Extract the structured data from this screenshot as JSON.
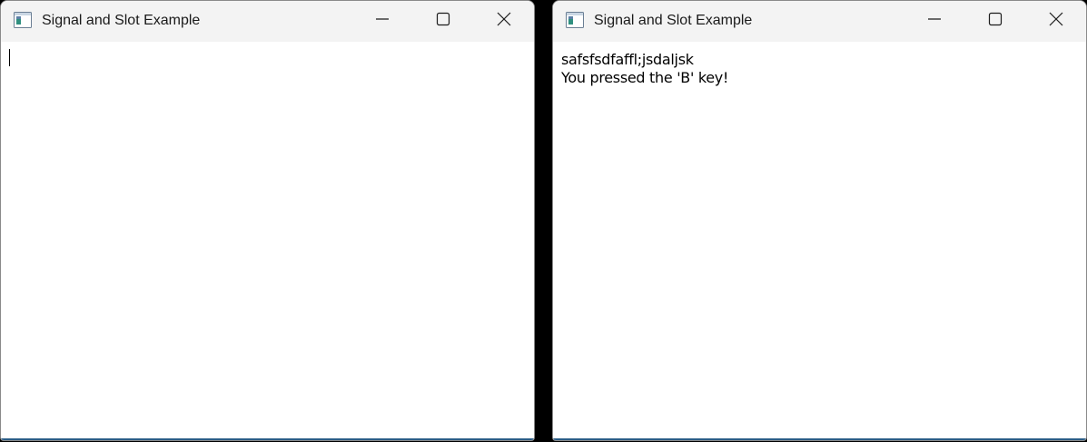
{
  "windows": [
    {
      "title": "Signal and Slot Example",
      "icon": "app-window-icon",
      "content_lines": []
    },
    {
      "title": "Signal and Slot Example",
      "icon": "app-window-icon",
      "content_lines": [
        "safsfsdfaffl;jsdaljsk",
        "You pressed the 'B' key!"
      ]
    }
  ],
  "caption_buttons": [
    "minimize-icon",
    "maximize-icon",
    "close-icon"
  ],
  "colors": {
    "titlebar_bg": "#f3f3f3",
    "client_bg": "#ffffff",
    "text": "#000000",
    "window_border": "#8a8a8a"
  }
}
